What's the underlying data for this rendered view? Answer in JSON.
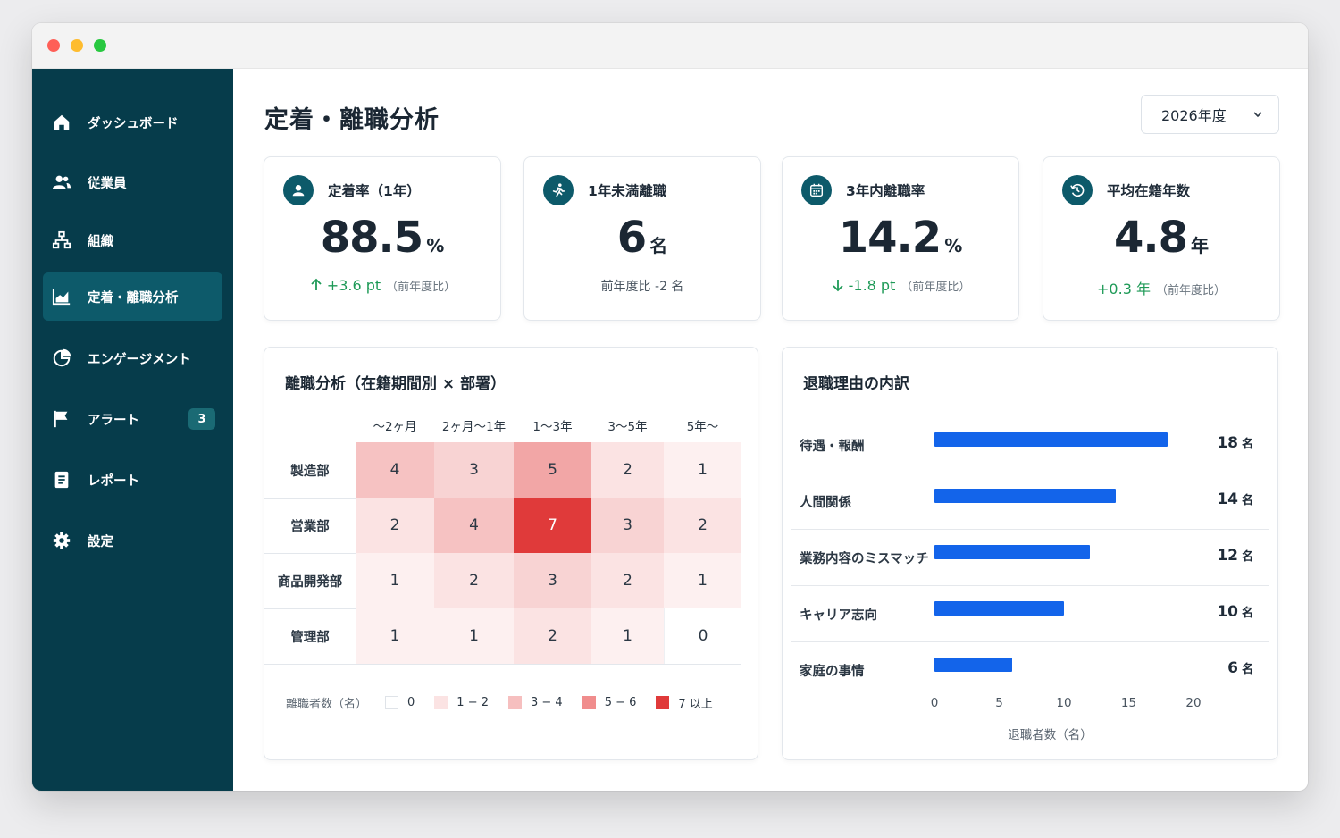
{
  "sidebar": {
    "items": [
      {
        "label": "ダッシュボード",
        "icon": "home-icon"
      },
      {
        "label": "従業員",
        "icon": "people-icon"
      },
      {
        "label": "組織",
        "icon": "org-chart-icon"
      },
      {
        "label": "定着・離職分析",
        "icon": "area-chart-icon",
        "active": true
      },
      {
        "label": "エンゲージメント",
        "icon": "pie-chart-icon"
      },
      {
        "label": "アラート",
        "icon": "flag-icon",
        "badge": "3"
      },
      {
        "label": "レポート",
        "icon": "document-icon"
      },
      {
        "label": "設定",
        "icon": "gear-icon"
      }
    ]
  },
  "header": {
    "title": "定着・離職分析",
    "year_selected": "2026年度"
  },
  "kpis": [
    {
      "label": "定着率（1年）",
      "value": "88.5",
      "unit": "%",
      "delta": "+3.6 pt",
      "note": "（前年度比）",
      "direction": "up",
      "icon": "user-circle-icon"
    },
    {
      "label": "1年未満離職",
      "value": "6",
      "unit": "名",
      "delta_text": "前年度比 -2 名",
      "icon": "running-icon"
    },
    {
      "label": "3年内離職率",
      "value": "14.2",
      "unit": "%",
      "delta": "-1.8 pt",
      "note": "（前年度比）",
      "direction": "down",
      "icon": "calendar-icon"
    },
    {
      "label": "平均在籍年数",
      "value": "4.8",
      "unit": "年",
      "delta": "+0.3 年",
      "note": "（前年度比）",
      "icon": "clock-icon"
    }
  ],
  "heatmap": {
    "title": "離職分析（在籍期間別 × 部署）",
    "columns": [
      "〜2ヶ月",
      "2ヶ月〜1年",
      "1〜3年",
      "3〜5年",
      "5年〜"
    ],
    "rows": [
      {
        "label": "製造部",
        "values": [
          4,
          3,
          5,
          2,
          1
        ]
      },
      {
        "label": "営業部",
        "values": [
          2,
          4,
          7,
          3,
          2
        ]
      },
      {
        "label": "商品開発部",
        "values": [
          1,
          2,
          3,
          2,
          1
        ]
      },
      {
        "label": "管理部",
        "values": [
          1,
          1,
          2,
          1,
          0
        ]
      }
    ],
    "legend_title": "離職者数（名）",
    "legend": [
      {
        "label": "0",
        "color": "#ffffff"
      },
      {
        "label": "1 − 2",
        "color": "#fbe3e3"
      },
      {
        "label": "3 − 4",
        "color": "#f6bfbf"
      },
      {
        "label": "5 − 6",
        "color": "#f08d8d"
      },
      {
        "label": "7 以上",
        "color": "#e03a3a"
      }
    ]
  },
  "chart_data": {
    "type": "bar",
    "title": "退職理由の内訳",
    "categories": [
      "待遇・報酬",
      "人間関係",
      "業務内容のミスマッチ",
      "キャリア志向",
      "家庭の事情"
    ],
    "values": [
      18,
      14,
      12,
      10,
      6
    ],
    "value_unit": "名",
    "xlabel": "退職者数（名）",
    "xlim": [
      0,
      20
    ],
    "xticks": [
      "0",
      "5",
      "10",
      "15",
      "20"
    ],
    "bar_color": "#1364ea",
    "orientation": "horizontal"
  }
}
